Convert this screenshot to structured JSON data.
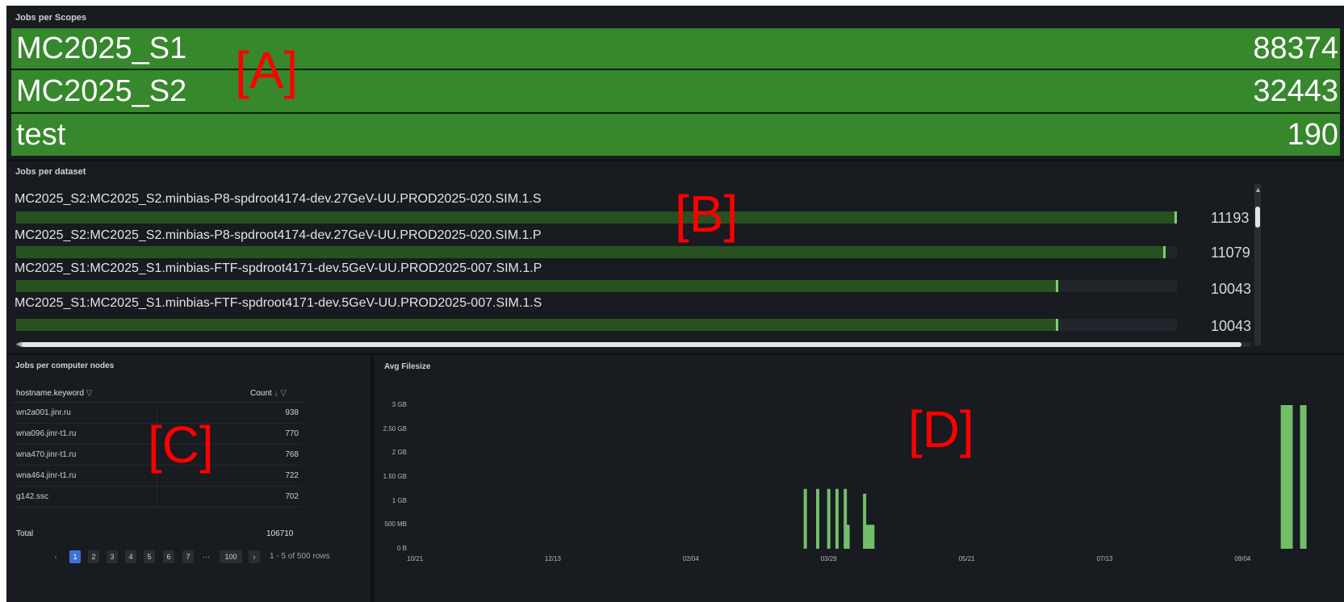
{
  "panel_a": {
    "title": "Jobs per Scopes",
    "rows": [
      {
        "name": "MC2025_S1",
        "value": "88374"
      },
      {
        "name": "MC2025_S2",
        "value": "32443"
      },
      {
        "name": "test",
        "value": "190"
      }
    ],
    "bar_color": "#37872d"
  },
  "panel_b": {
    "title": "Jobs per dataset",
    "rows": [
      {
        "label": "MC2025_S2:MC2025_S2.minbias-P8-spdroot4174-dev.27GeV-UU.PROD2025-020.SIM.1.S",
        "value": "11193",
        "fill": 1.0
      },
      {
        "label": "MC2025_S2:MC2025_S2.minbias-P8-spdroot4174-dev.27GeV-UU.PROD2025-020.SIM.1.P",
        "value": "11079",
        "fill": 0.99
      },
      {
        "label": "MC2025_S1:MC2025_S1.minbias-FTF-spdroot4171-dev.5GeV-UU.PROD2025-007.SIM.1.P",
        "value": "10043",
        "fill": 0.898
      },
      {
        "label": "MC2025_S1:MC2025_S1.minbias-FTF-spdroot4171-dev.5GeV-UU.PROD2025-007.SIM.1.S",
        "value": "10043",
        "fill": 0.898
      }
    ]
  },
  "panel_c": {
    "title": "Jobs per computer nodes",
    "col_host": "hostname.keyword",
    "col_count": "Count",
    "rows": [
      {
        "host": "wn2a001.jinr.ru",
        "count": "938"
      },
      {
        "host": "wna096.jinr-t1.ru",
        "count": "770"
      },
      {
        "host": "wna470.jinr-t1.ru",
        "count": "768"
      },
      {
        "host": "wna464.jinr-t1.ru",
        "count": "722"
      },
      {
        "host": "g142.ssc",
        "count": "702"
      }
    ],
    "total_label": "Total",
    "total_value": "106710",
    "pager": {
      "prev": "‹",
      "pages": [
        "1",
        "2",
        "3",
        "4",
        "5",
        "6",
        "7"
      ],
      "ellipsis": "···",
      "last": "100",
      "next": "›",
      "info": "1 - 5 of 500 rows",
      "current": "1"
    }
  },
  "panel_d": {
    "title": "Avg Filesize"
  },
  "chart_data": {
    "type": "bar",
    "title": "Avg Filesize",
    "y_ticks": [
      "0 B",
      "500 MB",
      "1 GB",
      "1.50 GB",
      "2 GB",
      "2.50 GB",
      "3 GB"
    ],
    "x_ticks": [
      "10/21",
      "12/13",
      "02/04",
      "03/29",
      "05/21",
      "07/13",
      "09/04"
    ],
    "ylim": [
      0,
      3.0
    ],
    "y_unit": "GB",
    "grid": false,
    "color": "#73bf69",
    "series": [
      {
        "x": [
          141.5,
          146,
          150,
          153,
          156,
          157,
          163,
          164,
          165,
          166,
          315,
          317,
          322
        ],
        "values": [
          1.25,
          1.25,
          1.25,
          1.25,
          1.25,
          0.5,
          1.15,
          0.5,
          0.5,
          0.5,
          3.0,
          3.0,
          3.0
        ]
      }
    ]
  },
  "overlay_labels": {
    "a": "[A]",
    "b": "[B]",
    "c": "[C]",
    "d": "[D]"
  }
}
